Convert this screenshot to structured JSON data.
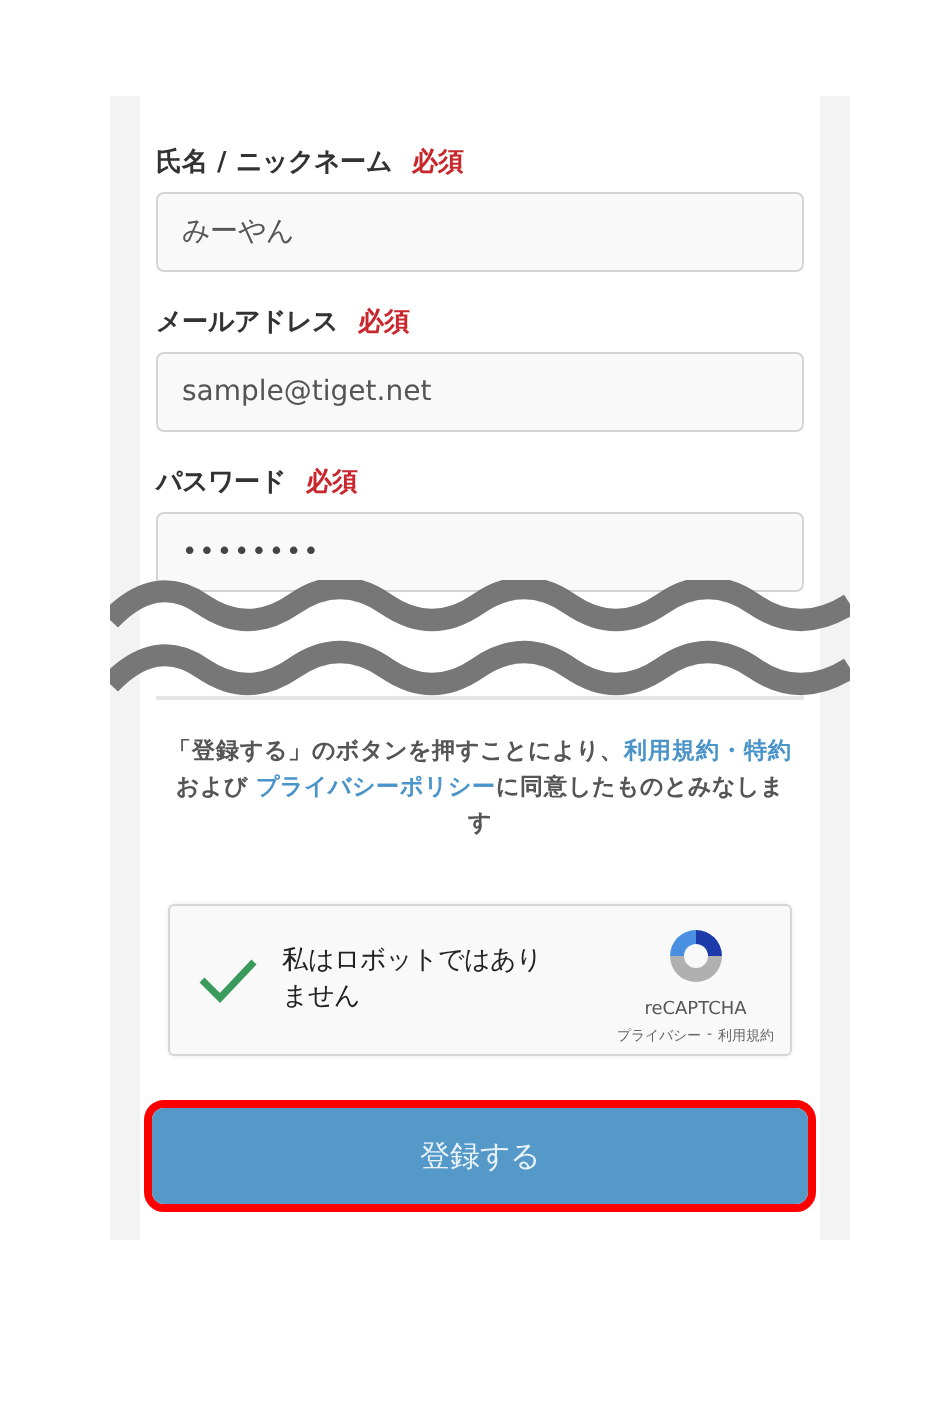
{
  "fields": [
    {
      "label": "氏名 / ニックネーム",
      "required": true,
      "badge": "必須",
      "kind": "text",
      "value": "みーやん"
    },
    {
      "label": "メールアドレス",
      "required": true,
      "badge": "必須",
      "kind": "text",
      "value": "sample@tiget.net"
    },
    {
      "label": "パスワード",
      "required": true,
      "badge": "必須",
      "kind": "password",
      "value": "••••••••"
    }
  ],
  "omitted_marker": true,
  "notice": [
    {
      "kind": "text",
      "text": "「登録する」のボタンを押すことにより、"
    },
    {
      "kind": "link",
      "text": "利用規約・特約"
    },
    {
      "kind": "text",
      "text": "および "
    },
    {
      "kind": "link",
      "text": "プライバシーポリシー"
    },
    {
      "kind": "text",
      "text": "に同意したものとみなします"
    }
  ],
  "captcha": {
    "checked": true,
    "label": "私はロボットではありません",
    "brand": "reCAPTCHA",
    "privacy": "プライバシー",
    "separator": "-",
    "terms": "利用規約"
  },
  "submit": {
    "label": "登録する",
    "highlighted": true
  }
}
